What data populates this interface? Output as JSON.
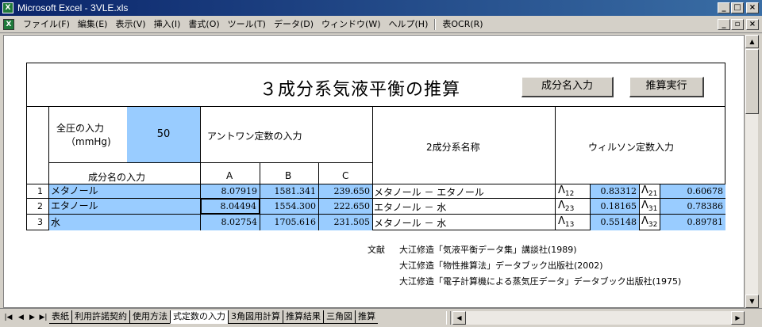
{
  "window": {
    "title": "Microsoft Excel - 3VLE.xls",
    "controls": {
      "minimize": "_",
      "maximize": "□",
      "close": "×"
    }
  },
  "menu": {
    "items": [
      "ファイル(F)",
      "編集(E)",
      "表示(V)",
      "挿入(I)",
      "書式(O)",
      "ツール(T)",
      "データ(D)",
      "ウィンドウ(W)",
      "ヘルプ(H)",
      "表OCR(R)"
    ]
  },
  "sheet": {
    "title": "３成分系気液平衡の推算",
    "buttons": {
      "component_input": "成分名入力",
      "run": "推算実行"
    },
    "pressure": {
      "label_line1": "全圧の入力",
      "label_line2": "（mmHg)",
      "value": "50"
    },
    "antoine_header": "アントワン定数の入力",
    "antoine_cols": [
      "A",
      "B",
      "C"
    ],
    "component_header": "成分名の入力",
    "binary_header": "2成分系名称",
    "wilson_header": "ウィルソン定数入力",
    "rows": [
      {
        "no": "1",
        "name": "メタノール",
        "A": "8.07919",
        "B": "1581.341",
        "C": "239.650",
        "binary": "メタノール － エタノール",
        "w1_sym": "Λ",
        "w1_sub": "12",
        "w1_val": "0.83312",
        "w2_sym": "Λ",
        "w2_sub": "21",
        "w2_val": "0.60678"
      },
      {
        "no": "2",
        "name": "エタノール",
        "A": "8.04494",
        "B": "1554.300",
        "C": "222.650",
        "binary": "エタノール － 水",
        "w1_sym": "Λ",
        "w1_sub": "23",
        "w1_val": "0.18165",
        "w2_sym": "Λ",
        "w2_sub": "31",
        "w2_val": "0.78386"
      },
      {
        "no": "3",
        "name": "水",
        "A": "8.02754",
        "B": "1705.616",
        "C": "231.505",
        "binary": "メタノール － 水",
        "w1_sym": "Λ",
        "w1_sub": "13",
        "w1_val": "0.55148",
        "w2_sym": "Λ",
        "w2_sub": "32",
        "w2_val": "0.89781"
      }
    ],
    "references": {
      "label": "文献",
      "lines": [
        "大江修造「気液平衡データ集」講談社(1989)",
        "大江修造「物性推算法」データブック出版社(2002)",
        "大江修造「電子計算機による蒸気圧データ」データブック出版社(1975)"
      ]
    }
  },
  "tabs": [
    "表紙",
    "利用許諾契約",
    "使用方法",
    "式定数の入力",
    "3角図用計算",
    "推算結果",
    "三角図",
    "推算"
  ],
  "active_tab": "式定数の入力",
  "colors": {
    "input_blue": "#99ccff",
    "titlebar": "#0a246a"
  }
}
